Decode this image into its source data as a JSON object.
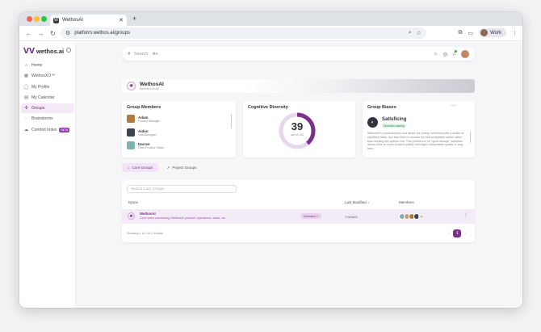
{
  "browser": {
    "tab_title": "WethosAI",
    "tab_close": "✕",
    "new_tab": "+",
    "url": "platform.wethos.ai/groups",
    "profile_label": "Work"
  },
  "sidebar": {
    "logo": "wethos.ai",
    "items": [
      {
        "label": "Home",
        "icon": "home-icon"
      },
      {
        "label": "WethosXO™",
        "icon": "grid-icon"
      },
      {
        "label": "My Profile",
        "icon": "user-icon"
      },
      {
        "label": "My Calendar",
        "icon": "calendar-icon"
      },
      {
        "label": "Groups",
        "icon": "groups-icon",
        "active": true
      },
      {
        "label": "Brainstorms",
        "icon": "bulb-icon"
      },
      {
        "label": "Comfort Index",
        "icon": "cloud-icon",
        "badge": "BETA"
      }
    ]
  },
  "search": {
    "placeholder": "Search",
    "shortcut": "⌘K"
  },
  "group_header": {
    "title": "WethosAI",
    "subtitle": "Selected Group"
  },
  "members_card": {
    "title": "Group Members",
    "members": [
      {
        "name": "Adam",
        "role": "Product Manager",
        "color": "#b07a3c"
      },
      {
        "name": "Aiden",
        "role": "Lead Designer",
        "color": "#3b4250"
      },
      {
        "name": "Darren",
        "role": "Chief Product Officer",
        "color": "#7fb3b0"
      }
    ]
  },
  "diversity_card": {
    "title": "Cognitive Diversity",
    "value": "39",
    "fraction": 0.39,
    "caption": "out of 100",
    "accent": "#7b2f8e"
  },
  "biases_card": {
    "title": "Group Biases",
    "bias_name": "Satisficing",
    "bias_tag": "Decision-making",
    "description": "WethosAI's practical focus and desire for variety, combined with a dislike of repetitive tasks, can lead them to choose the first acceptable option rather than seeking the optimal one. This preference for \"good enough\" solutions allows them to move forward quickly, but might compromise quality or long-term."
  },
  "tabs": {
    "core": "Core Groups",
    "project": "Project Groups"
  },
  "table": {
    "search_placeholder": "Search Core Groups",
    "headers": {
      "name": "Name",
      "last_modified": "Last Modified ↓",
      "members": "Members"
    },
    "rows": [
      {
        "name": "WethosAI",
        "description": "Core team overseeing WethosAI product, operations, sales, an...",
        "selected": "Selected ✓",
        "date": "7/9/2025",
        "member_colors": [
          "#7fb3b0",
          "#d49a7a",
          "#b07a3c",
          "#3b4250"
        ],
        "more_count": "+1"
      }
    ],
    "footer": "Showing 1 to 1 of 1 entries",
    "page": "1"
  }
}
